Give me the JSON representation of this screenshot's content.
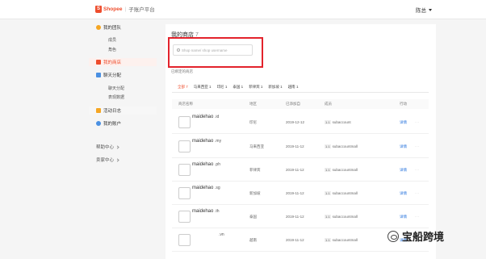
{
  "header": {
    "logo_mark": "S",
    "logo_text": "Shopee",
    "logo_sep": "|",
    "logo_sub": "子账户平台",
    "user_name": "陈总"
  },
  "sidebar": {
    "team": {
      "label": "我的团队",
      "subs": [
        "成员",
        "角色"
      ]
    },
    "shops": {
      "label": "我的商店"
    },
    "chat": {
      "label": "聊天分配",
      "subs": [
        "聊天分配",
        "表现数据"
      ]
    },
    "activity": {
      "label": "活动日志"
    },
    "account": {
      "label": "我的账户"
    },
    "help": {
      "label": "帮助中心"
    },
    "seller": {
      "label": "卖家中心"
    }
  },
  "main": {
    "title": "我的商店",
    "title_count": "7",
    "search_placeholder": "Shop name/ shop username",
    "bound_text": "已绑定的商店",
    "tabs": [
      {
        "label": "全部",
        "count": "7"
      },
      {
        "label": "马来西亚",
        "count": "1"
      },
      {
        "label": "印尼",
        "count": "1"
      },
      {
        "label": "泰国",
        "count": "1"
      },
      {
        "label": "菲律宾",
        "count": "1"
      },
      {
        "label": "新加坡",
        "count": "1"
      },
      {
        "label": "越南",
        "count": "1"
      }
    ],
    "columns": [
      "商店名称",
      "地区",
      "已添加自",
      "成员",
      "行动"
    ],
    "rows": [
      {
        "name": "maidehao",
        "suffix": ".id",
        "region": "印尼",
        "date": "2019-12-12",
        "role": "1.1",
        "member": "subaccount",
        "action": "详情"
      },
      {
        "name": "maidehao",
        "suffix": ".my",
        "region": "马来西亚",
        "date": "2019-11-12",
        "role": "1.1",
        "member": "subaccountmall",
        "action": "详情"
      },
      {
        "name": "maidehao",
        "suffix": ".ph",
        "region": "菲律宾",
        "date": "2019-11-12",
        "role": "1.1",
        "member": "subaccountmall",
        "action": "详情"
      },
      {
        "name": "maidehao",
        "suffix": ".sg",
        "region": "新加坡",
        "date": "2019-11-12",
        "role": "1.1",
        "member": "subaccountmall",
        "action": "详情"
      },
      {
        "name": "maidehao",
        "suffix": ".th",
        "region": "泰国",
        "date": "2019-11-12",
        "role": "1.1",
        "member": "subaccountmall",
        "action": "详情"
      },
      {
        "name": "",
        "suffix": ".vn",
        "region": "越南",
        "date": "2019-11-12",
        "role": "1.1",
        "member": "subaccountmall",
        "action": "详情"
      }
    ],
    "more_glyph": "···"
  },
  "watermark": {
    "text": "宝船跨境"
  },
  "colors": {
    "brand": "#ee4d2d",
    "highlight": "#e3232c",
    "link": "#2673dd"
  }
}
